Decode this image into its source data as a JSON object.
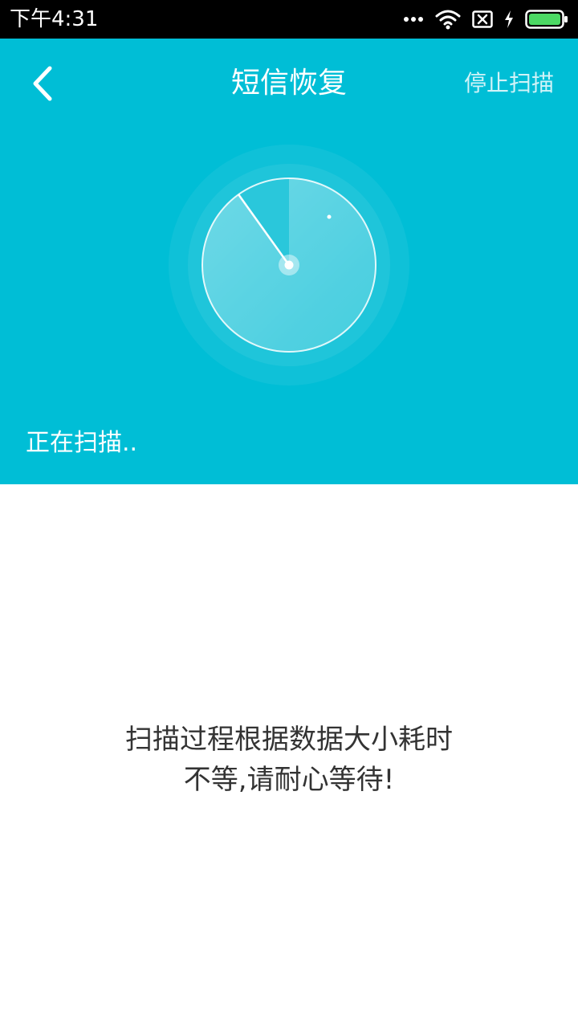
{
  "status_bar": {
    "time": "下午4:31",
    "icons": [
      "more-dots-icon",
      "wifi-icon",
      "sim-x-icon",
      "charging-bolt-icon",
      "battery-icon"
    ]
  },
  "header": {
    "title": "短信恢复",
    "stop_label": "停止扫描",
    "back_icon": "chevron-left-icon"
  },
  "scan": {
    "status_text": "正在扫描.."
  },
  "message": {
    "line1": "扫描过程根据数据大小耗时",
    "line2": "不等,请耐心等待!"
  },
  "colors": {
    "accent": "#00BED6",
    "battery": "#4CD964",
    "text": "#333333"
  }
}
